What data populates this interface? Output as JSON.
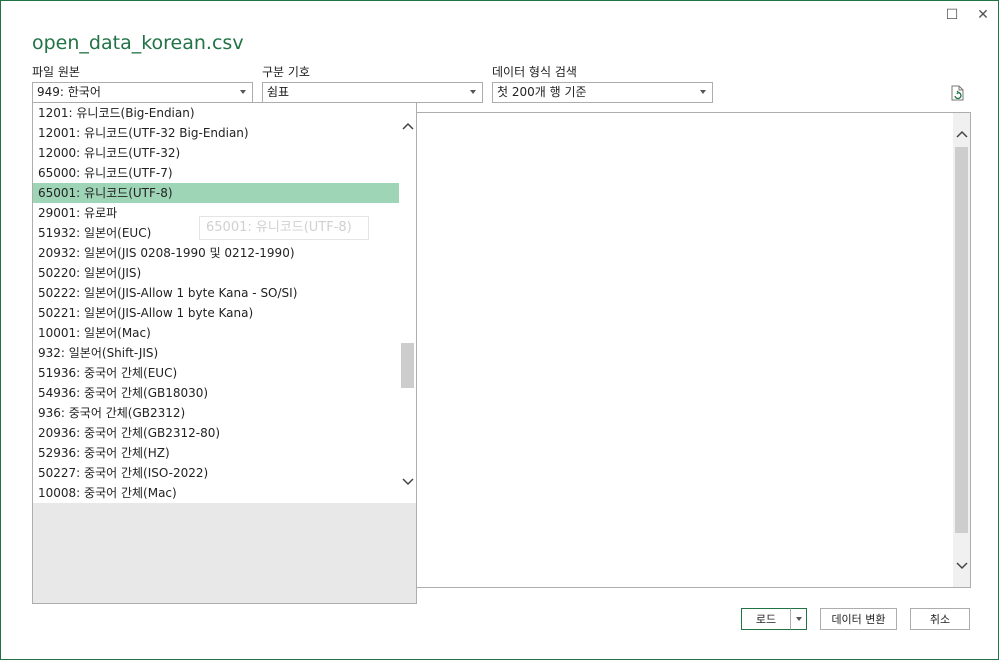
{
  "window": {
    "minimize_glyph": "☐",
    "close_glyph": "✕"
  },
  "title": "open_data_korean.csv",
  "controls": {
    "file_origin": {
      "label": "파일 원본",
      "value": "949: 한국어"
    },
    "delimiter": {
      "label": "구분 기호",
      "value": "쉼표"
    },
    "data_type_detection": {
      "label": "데이터 형식 검색",
      "value": "첫 200개 행 기준"
    }
  },
  "encoding_list": {
    "items": [
      "1201: 유니코드(Big-Endian)",
      "12001: 유니코드(UTF-32 Big-Endian)",
      "12000: 유니코드(UTF-32)",
      "65000: 유니코드(UTF-7)",
      "65001: 유니코드(UTF-8)",
      "29001: 유로파",
      "51932: 일본어(EUC)",
      "20932: 일본어(JIS 0208-1990 및 0212-1990)",
      "50220: 일본어(JIS)",
      "50222: 일본어(JIS-Allow 1 byte Kana - SO/SI)",
      "50221: 일본어(JIS-Allow 1 byte Kana)",
      "10001: 일본어(Mac)",
      "932: 일본어(Shift-JIS)",
      "51936: 중국어 간체(EUC)",
      "54936: 중국어 간체(GB18030)",
      "936: 중국어 간체(GB2312)",
      "20936: 중국어 간체(GB2312-80)",
      "52936: 중국어 간체(HZ)",
      "50227: 중국어 간체(ISO-2022)",
      "10008: 중국어 간체(Mac)"
    ],
    "selected_index": 4
  },
  "tooltip": "65001: 유니코드(UTF-8)",
  "buttons": {
    "load": "로드",
    "transform": "데이터 변환",
    "cancel": "취소"
  },
  "icons": {
    "refresh": "refresh-file-icon",
    "scroll_up": "chevron-up-icon",
    "scroll_down": "chevron-down-icon"
  },
  "colors": {
    "accent": "#217346",
    "selected_row": "#9fd5b7"
  }
}
